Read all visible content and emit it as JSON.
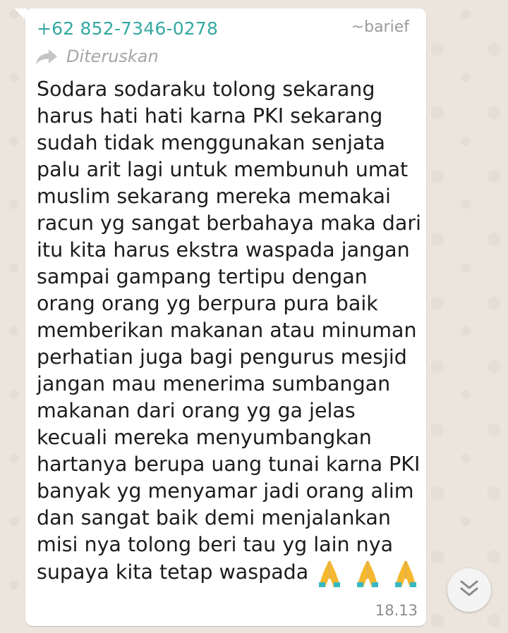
{
  "chat": {
    "sender_phone": "+62 852-7346-0278",
    "sender_pushname": "~barief",
    "forwarded_label": "Diteruskan",
    "message_text": "Sodara sodaraku tolong sekarang harus hati hati karna PKI sekarang sudah tidak menggunakan senjata palu arit lagi untuk membunuh umat muslim sekarang mereka memakai racun yg sangat berbahaya maka dari itu kita harus ekstra waspada jangan sampai gampang tertipu dengan orang orang yg berpura pura baik memberikan makanan atau minuman perhatian juga bagi pengurus mesjid jangan mau menerima sumbangan makanan dari orang yg ga jelas kecuali mereka menyumbangkan hartanya berupa uang tunai karna PKI banyak yg menyamar jadi orang alim dan sangat baik demi menjalankan misi nya tolong beri tau yg lain nya supaya kita tetap waspada",
    "emojis": [
      "folded-hands-icon",
      "folded-hands-icon",
      "folded-hands-icon"
    ],
    "timestamp": "18.13"
  },
  "icons": {
    "forward": "forward-arrow-icon",
    "scroll_down": "double-chevron-down-icon"
  },
  "colors": {
    "sender_name": "#35a9a0",
    "bubble": "#ffffff",
    "wallpaper": "#ece5dd",
    "emoji": "#f5b82e"
  }
}
